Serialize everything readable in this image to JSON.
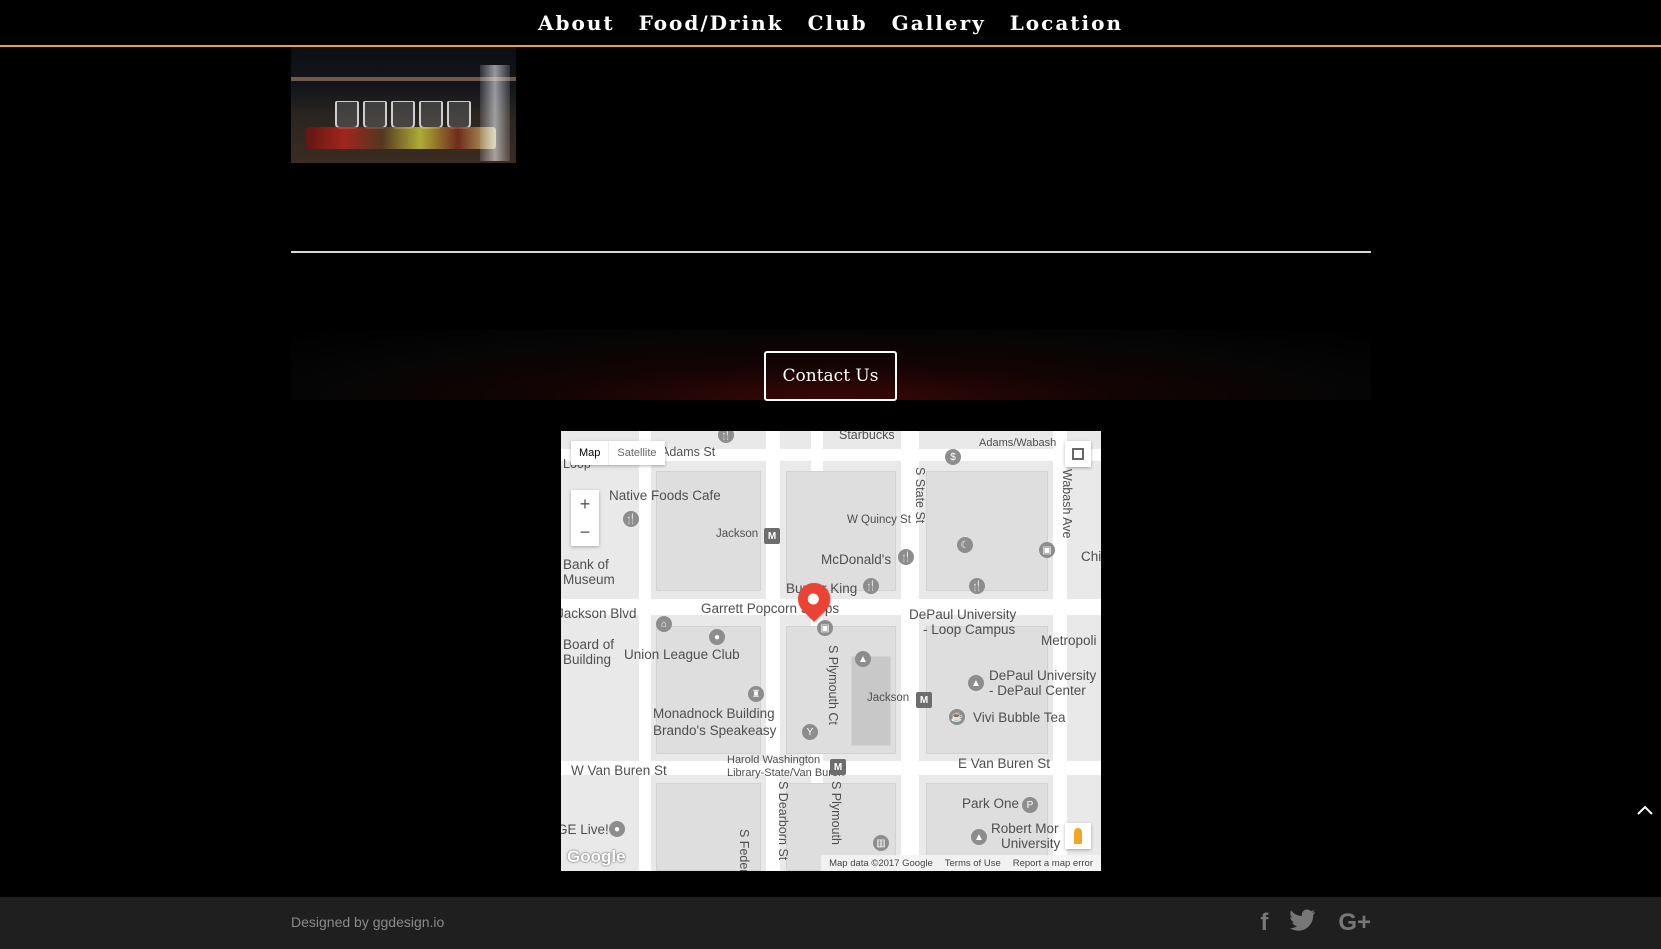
{
  "nav": {
    "items": [
      {
        "label": "About"
      },
      {
        "label": "Food/Drink"
      },
      {
        "label": "Club"
      },
      {
        "label": "Gallery"
      },
      {
        "label": "Location"
      }
    ]
  },
  "contact": {
    "button_label": "Contact Us"
  },
  "map": {
    "type_map": "Map",
    "type_satellite": "Satellite",
    "zoom_in": "+",
    "zoom_out": "−",
    "logo": "Google",
    "footer": {
      "data": "Map data ©2017 Google",
      "terms": "Terms of Use",
      "report": "Report a map error"
    },
    "labels": {
      "adams_st": "Adams St",
      "adams_wabash": "Adams/Wabash",
      "native_foods": "Native Foods Cafe",
      "w_quincy": "W Quincy St",
      "jackson_top": "Jackson",
      "mcdonalds": "McDonald's",
      "burger_king": "Burger King",
      "garrett": "Garrett Popcorn Shops",
      "jackson_blvd": "Jackson Blvd",
      "bank_of": "Bank of",
      "museum": "Museum",
      "board_of": "Board of",
      "building": "Building",
      "union_league": "Union League Club",
      "depaul_loop": "DePaul University",
      "loop_campus": "- Loop Campus",
      "metropolis": "Metropoli",
      "depaul_center": "DePaul University",
      "depaul_center_2": "- DePaul Center",
      "jackson_mid": "Jackson",
      "monadnock": "Monadnock Building",
      "brandos": "Brando's Speakeasy",
      "vivi": "Vivi Bubble Tea",
      "w_van_buren": "W Van Buren St",
      "harold_1": "Harold Washington",
      "harold_2": "Library-State/Van Buren",
      "e_van_buren": "E Van Buren St",
      "park_one": "Park One",
      "ge_live": "GE Live!",
      "robert_1": "Robert Mor",
      "robert_2": "University",
      "starbucks": "Starbucks",
      "s_state": "S State St",
      "wabash": "Wabash Ave",
      "s_plymouth_ct": "S Plymouth Ct",
      "s_dearborn": "S Dearborn St",
      "s_plymouth": "S Plymouth",
      "s_federal": "S Federal",
      "chicago": "Chica",
      "loop": "Loop"
    }
  },
  "footer": {
    "credit_prefix": "Designed by ",
    "credit_link": "ggdesign.io"
  },
  "social": [
    "facebook-icon",
    "twitter-icon",
    "google-plus-icon"
  ]
}
